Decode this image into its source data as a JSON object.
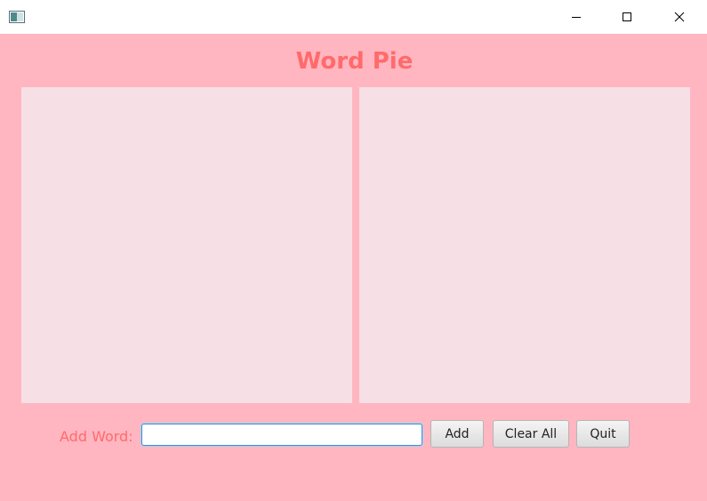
{
  "window": {
    "title": "",
    "controls": {
      "minimize_icon": "minimize-icon",
      "maximize_icon": "maximize-icon",
      "close_icon": "close-icon"
    }
  },
  "app": {
    "title": "Word Pie",
    "accent_color": "#ff6b6b",
    "background_color": "#ffb6c1",
    "panel_color": "#f7e0e5"
  },
  "form": {
    "add_label": "Add Word:",
    "input_value": "",
    "buttons": {
      "add": "Add",
      "clear": "Clear All",
      "quit": "Quit"
    }
  }
}
